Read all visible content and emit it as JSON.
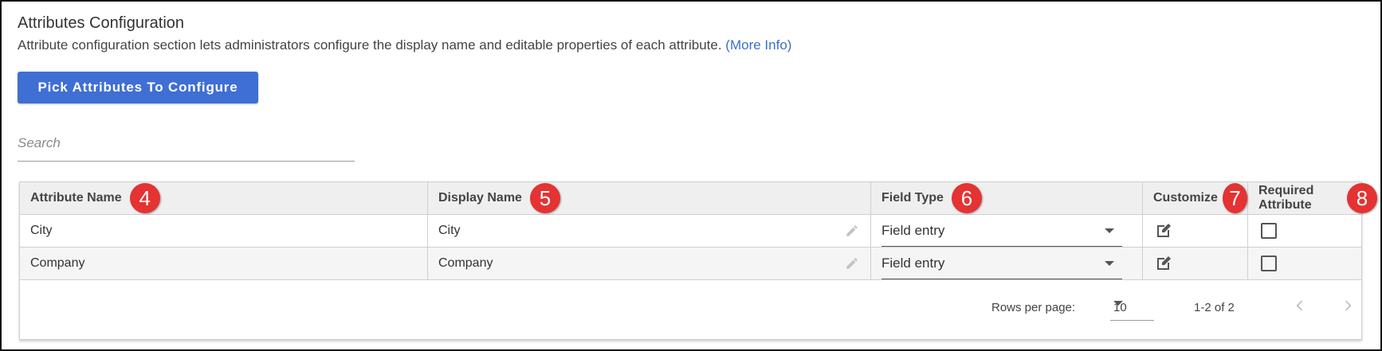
{
  "header": {
    "title": "Attributes Configuration",
    "description": "Attribute configuration section lets administrators configure the display name and editable properties of each attribute.",
    "more_info": "(More Info)"
  },
  "pick_button": "Pick Attributes To Configure",
  "search": {
    "placeholder": "Search",
    "value": ""
  },
  "table": {
    "columns": [
      {
        "label": "Attribute Name",
        "badge": "4"
      },
      {
        "label": "Display Name",
        "badge": "5"
      },
      {
        "label": "Field Type",
        "badge": "6"
      },
      {
        "label": "Customize",
        "badge": "7"
      },
      {
        "label": "Required Attribute",
        "badge": "8"
      }
    ],
    "rows": [
      {
        "attribute": "City",
        "display": "City",
        "field_type": "Field entry",
        "required": false
      },
      {
        "attribute": "Company",
        "display": "Company",
        "field_type": "Field entry",
        "required": false
      }
    ]
  },
  "footer": {
    "rows_per_page_label": "Rows per page:",
    "rows_per_page_value": "10",
    "range": "1-2 of 2"
  },
  "icons": {
    "pencil": "pencil-icon",
    "edit": "edit-square-icon",
    "dropdown": "caret-down-icon",
    "prev": "chevron-left-icon",
    "next": "chevron-right-icon"
  },
  "colors": {
    "accent": "#3f6fd4",
    "badge": "#e53232",
    "link": "#3b6fd3"
  }
}
